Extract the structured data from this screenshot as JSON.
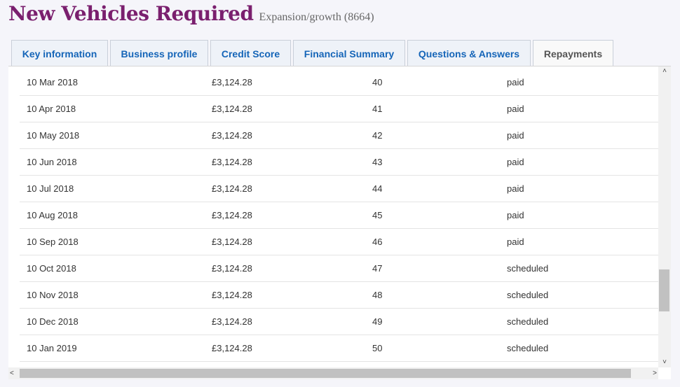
{
  "header": {
    "title": "New Vehicles Required",
    "subtitle": "Expansion/growth (8664)"
  },
  "tabs": [
    {
      "label": "Key information"
    },
    {
      "label": "Business profile"
    },
    {
      "label": "Credit Score"
    },
    {
      "label": "Financial Summary"
    },
    {
      "label": "Questions & Answers"
    },
    {
      "label": "Repayments"
    }
  ],
  "active_tab": "Repayments",
  "repayments": [
    {
      "date": "10 Mar 2018",
      "amount": "£3,124.28",
      "number": "40",
      "status": "paid"
    },
    {
      "date": "10 Apr 2018",
      "amount": "£3,124.28",
      "number": "41",
      "status": "paid"
    },
    {
      "date": "10 May 2018",
      "amount": "£3,124.28",
      "number": "42",
      "status": "paid"
    },
    {
      "date": "10 Jun 2018",
      "amount": "£3,124.28",
      "number": "43",
      "status": "paid"
    },
    {
      "date": "10 Jul 2018",
      "amount": "£3,124.28",
      "number": "44",
      "status": "paid"
    },
    {
      "date": "10 Aug 2018",
      "amount": "£3,124.28",
      "number": "45",
      "status": "paid"
    },
    {
      "date": "10 Sep 2018",
      "amount": "£3,124.28",
      "number": "46",
      "status": "paid"
    },
    {
      "date": "10 Oct 2018",
      "amount": "£3,124.28",
      "number": "47",
      "status": "scheduled"
    },
    {
      "date": "10 Nov 2018",
      "amount": "£3,124.28",
      "number": "48",
      "status": "scheduled"
    },
    {
      "date": "10 Dec 2018",
      "amount": "£3,124.28",
      "number": "49",
      "status": "scheduled"
    },
    {
      "date": "10 Jan 2019",
      "amount": "£3,124.28",
      "number": "50",
      "status": "scheduled"
    }
  ],
  "colors": {
    "title": "#7a1f6e",
    "tab_text": "#1565b8",
    "active_tab_text": "#555555"
  }
}
